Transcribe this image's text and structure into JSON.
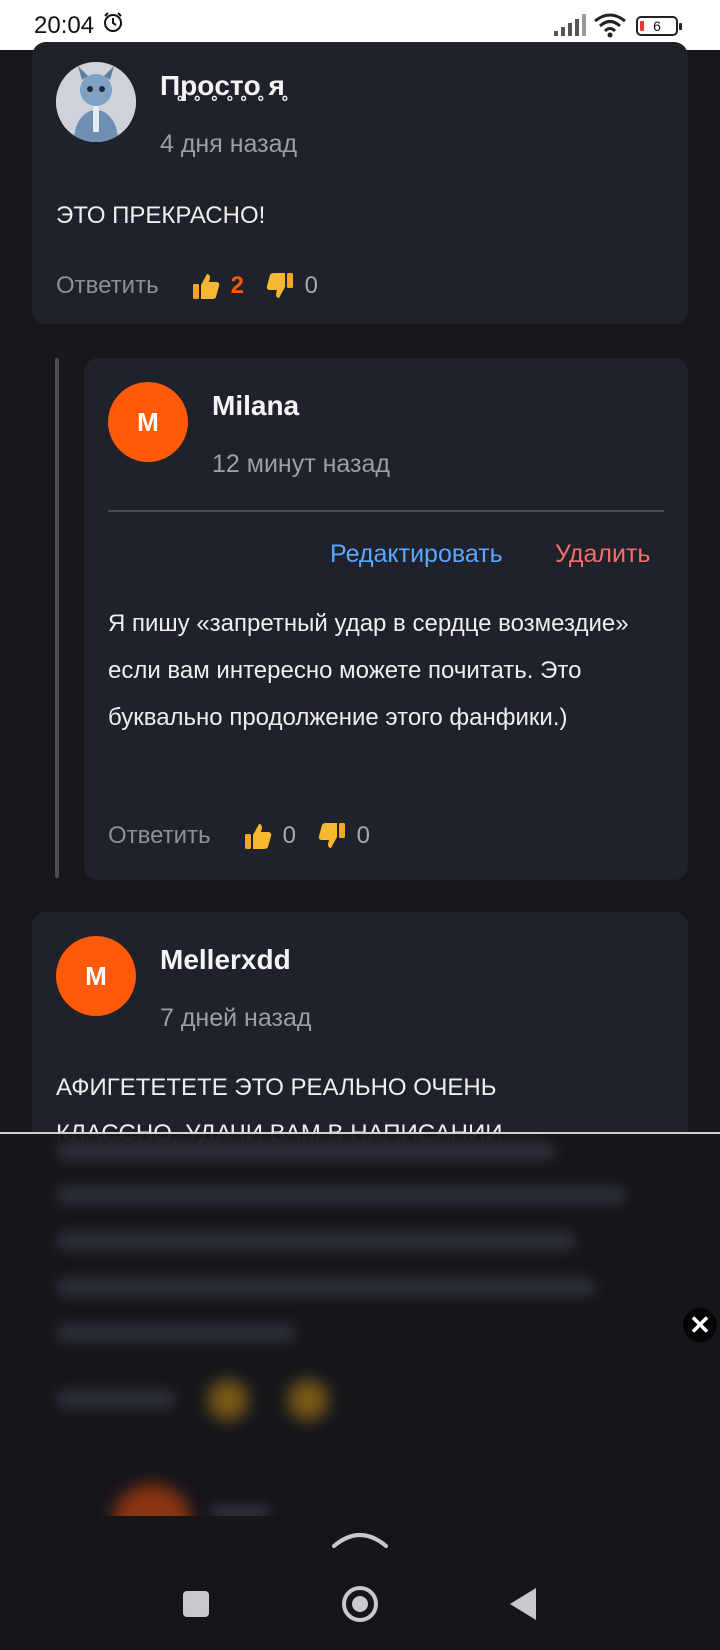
{
  "status_bar": {
    "time": "20:04",
    "battery": "6"
  },
  "comments": [
    {
      "author": "П̥р̥о̥с̥т̥о̥ я̥",
      "time_ago": "4 дня назад",
      "text": "ЭТО ПРЕКРАСНО!",
      "reply_label": "Ответить",
      "likes": "2",
      "dislikes": "0"
    },
    {
      "avatar_letter": "M",
      "author": "Milana",
      "time_ago": "12 минут назад",
      "edit_label": "Редактировать",
      "delete_label": "Удалить",
      "text": "Я пишу «запретный удар в сердце возмездие» если вам интересно можете почитать. Это буквально продолжение этого фанфики.)",
      "reply_label": "Ответить",
      "likes": "0",
      "dislikes": "0"
    },
    {
      "avatar_letter": "M",
      "author": "Mellerxdd",
      "time_ago": "7 дней назад",
      "text": "АФИГЕТЕТЕТЕ ЭТО РЕАЛЬНО ОЧЕНЬ",
      "text_cut": "КЛАССНО, УДАЧИ ВАМ В НАПИСАНИИ"
    }
  ],
  "overlay": {
    "close_symbol": "✕"
  },
  "colors": {
    "accent": "#ff5a0a",
    "edit": "#5aa7ff",
    "delete": "#f0706a",
    "card": "#1f212b",
    "background": "#17171c"
  }
}
